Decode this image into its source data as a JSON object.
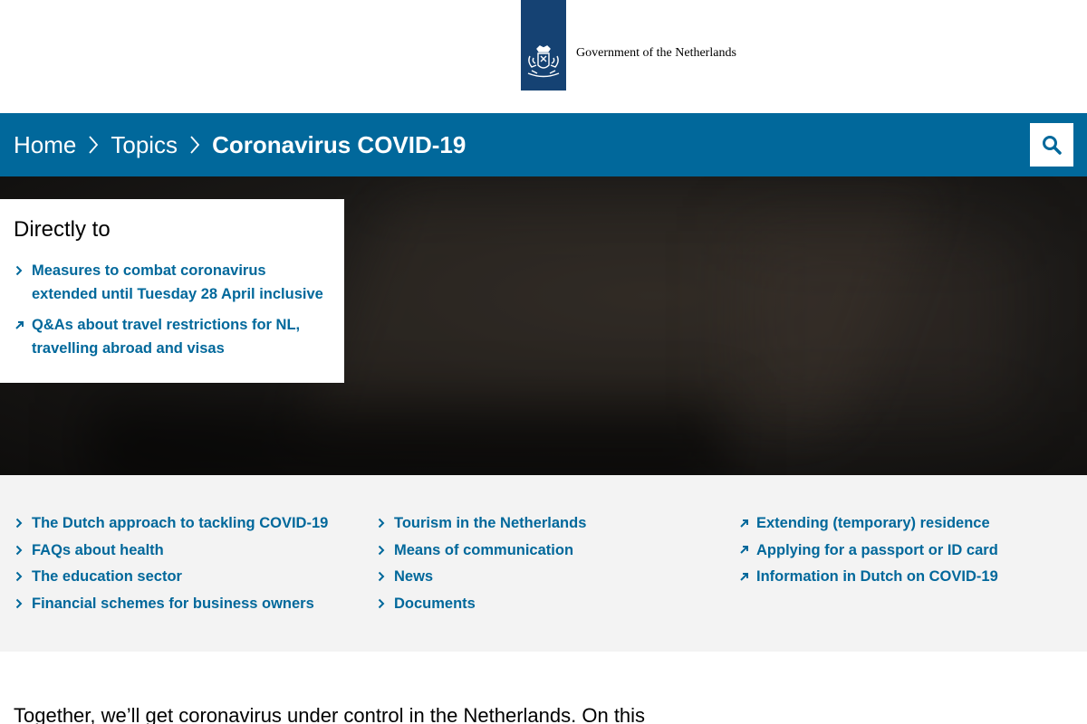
{
  "header": {
    "logo_text": "Government of the Netherlands",
    "brand_color": "#154273"
  },
  "breadcrumb": {
    "items": [
      "Home",
      "Topics",
      "Coronavirus COVID-19"
    ],
    "bar_color": "#01689b"
  },
  "search": {
    "icon": "search-icon"
  },
  "directly_to": {
    "heading": "Directly to",
    "links": [
      {
        "label": "Measures to combat coronavirus extended until Tuesday 28 April inclusive",
        "icon": "chevron-right-icon"
      },
      {
        "label": "Q&As about travel restrictions for NL, travelling abroad and visas",
        "icon": "external-arrow-icon"
      }
    ]
  },
  "quick_links": {
    "columns": [
      [
        {
          "label": "The Dutch approach to tackling COVID-19",
          "icon": "chevron-right-icon"
        },
        {
          "label": "FAQs about health",
          "icon": "chevron-right-icon"
        },
        {
          "label": "The education sector",
          "icon": "chevron-right-icon"
        },
        {
          "label": "Financial schemes for business owners",
          "icon": "chevron-right-icon"
        }
      ],
      [
        {
          "label": "Tourism in the Netherlands",
          "icon": "chevron-right-icon"
        },
        {
          "label": "Means of communication",
          "icon": "chevron-right-icon"
        },
        {
          "label": "News",
          "icon": "chevron-right-icon"
        },
        {
          "label": "Documents",
          "icon": "chevron-right-icon"
        }
      ],
      [
        {
          "label": "Extending (temporary) residence",
          "icon": "external-arrow-icon"
        },
        {
          "label": "Applying for a passport or ID card",
          "icon": "external-arrow-icon"
        },
        {
          "label": "Information in Dutch on COVID-19",
          "icon": "external-arrow-icon"
        }
      ]
    ]
  },
  "intro": {
    "text": "Together, we’ll get coronavirus under control in the Netherlands. On this"
  }
}
